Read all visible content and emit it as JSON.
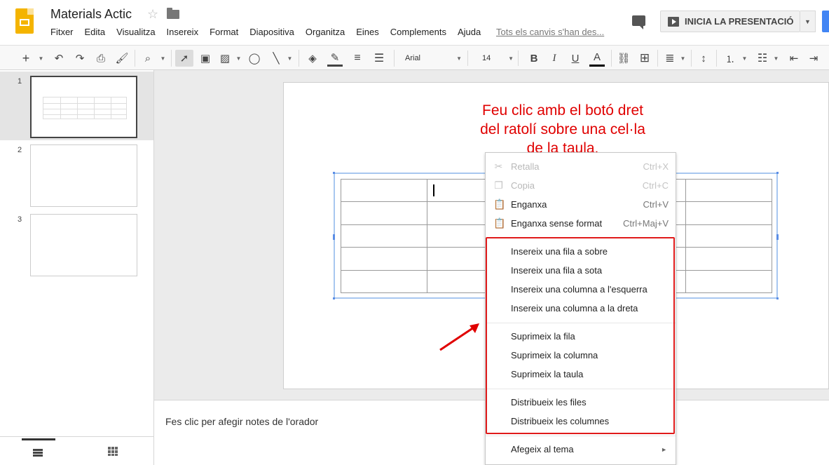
{
  "app": {
    "doc_title": "Materials Actic",
    "save_status": "Tots els canvis s'han des...",
    "present_label": "INICIA LA PRESENTACIÓ"
  },
  "menubar": [
    "Fitxer",
    "Edita",
    "Visualitza",
    "Insereix",
    "Format",
    "Diapositiva",
    "Organitza",
    "Eines",
    "Complements",
    "Ajuda"
  ],
  "toolbar": {
    "font_name": "Arial",
    "font_size": "14"
  },
  "filmstrip": {
    "slides": [
      {
        "number": "1"
      },
      {
        "number": "2"
      },
      {
        "number": "3"
      }
    ]
  },
  "slide": {
    "instruction": "Feu clic amb el botó dret\ndel ratolí sobre una cel·la\nde la taula."
  },
  "notes": {
    "placeholder": "Fes clic per afegir notes de l'orador"
  },
  "context_menu": {
    "clipboard": [
      {
        "label": "Retalla",
        "shortcut": "Ctrl+X",
        "icon": "scissors-icon",
        "enabled": false
      },
      {
        "label": "Copia",
        "shortcut": "Ctrl+C",
        "icon": "copy-icon",
        "enabled": false
      },
      {
        "label": "Enganxa",
        "shortcut": "Ctrl+V",
        "icon": "paste-icon",
        "enabled": true
      },
      {
        "label": "Enganxa sense format",
        "shortcut": "Ctrl+Maj+V",
        "icon": "paste-plain-icon",
        "enabled": true
      }
    ],
    "insert": [
      "Insereix una fila a sobre",
      "Insereix una fila a sota",
      "Insereix una columna a l'esquerra",
      "Insereix una columna a la dreta"
    ],
    "delete": [
      "Suprimeix la fila",
      "Suprimeix la columna",
      "Suprimeix la taula"
    ],
    "distribute": [
      "Distribueix les files",
      "Distribueix les columnes"
    ],
    "theme": "Afegeix al tema"
  },
  "colors": {
    "annotation_red": "#e00000",
    "highlight_red": "#e01b1b",
    "selection_blue": "#a8c7f0",
    "logo_yellow": "#f4b400"
  }
}
